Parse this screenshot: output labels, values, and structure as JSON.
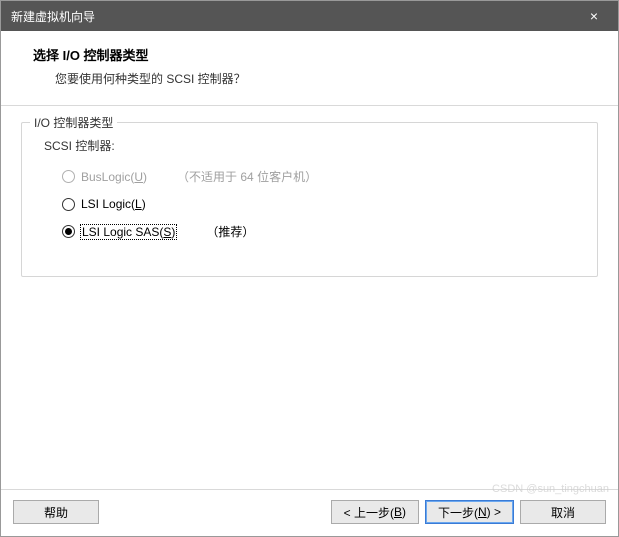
{
  "titlebar": {
    "title": "新建虚拟机向导",
    "close": "×"
  },
  "header": {
    "heading": "选择 I/O 控制器类型",
    "sub": "您要使用何种类型的 SCSI 控制器？"
  },
  "fieldset": {
    "legend": "I/O 控制器类型",
    "scsi_label": "SCSI 控制器:",
    "options": [
      {
        "label_pre": "BusLogic(",
        "accel": "U",
        "label_post": ")",
        "hint": "（不适用于 64 位客户机）",
        "disabled": true,
        "selected": false,
        "focused": false
      },
      {
        "label_pre": "LSI Logic(",
        "accel": "L",
        "label_post": ")",
        "hint": "",
        "disabled": false,
        "selected": false,
        "focused": false
      },
      {
        "label_pre": "LSI Logic SAS(",
        "accel": "S",
        "label_post": ")",
        "hint": "（推荐）",
        "disabled": false,
        "selected": true,
        "focused": true
      }
    ]
  },
  "footer": {
    "help": "帮助",
    "back_pre": "< 上一步(",
    "back_accel": "B",
    "back_post": ")",
    "next_pre": "下一步(",
    "next_accel": "N",
    "next_post": ") >",
    "cancel": "取消"
  },
  "watermark": "CSDN @sun_tingchuan"
}
